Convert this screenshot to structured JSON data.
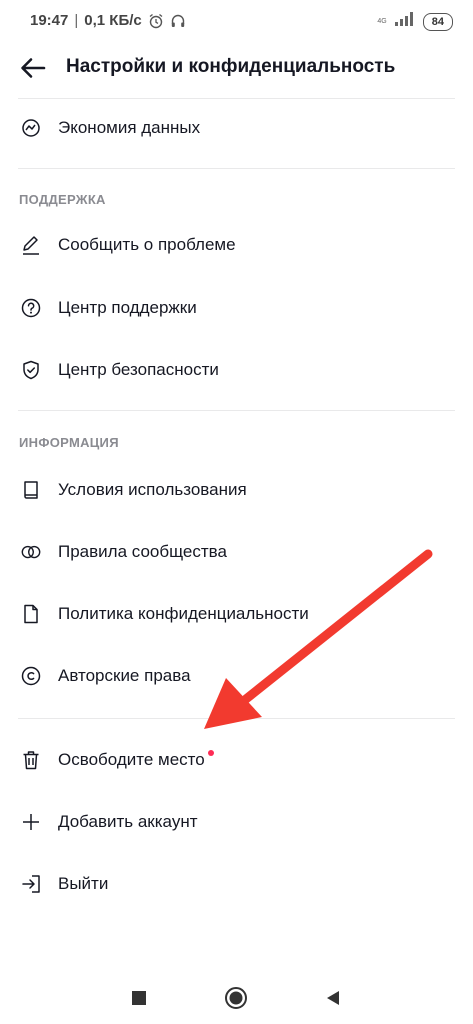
{
  "status_bar": {
    "time": "19:47",
    "separator": "|",
    "speed": "0,1 КБ/с",
    "network": "4G",
    "battery": "84"
  },
  "header": {
    "title": "Настройки и конфиденциальность"
  },
  "items_top": {
    "data_saver": "Экономия данных"
  },
  "support": {
    "title": "ПОДДЕРЖКА",
    "report": "Сообщить о проблеме",
    "help_center": "Центр поддержки",
    "safety_center": "Центр безопасности"
  },
  "info": {
    "title": "ИНФОРМАЦИЯ",
    "terms": "Условия использования",
    "guidelines": "Правила сообщества",
    "privacy": "Политика конфиденциальности",
    "copyright": "Авторские права"
  },
  "account": {
    "free_space": "Освободите место",
    "add_account": "Добавить аккаунт",
    "logout": "Выйти"
  },
  "colors": {
    "accent_dot": "#fe2c55",
    "arrow": "#f23a2f"
  }
}
